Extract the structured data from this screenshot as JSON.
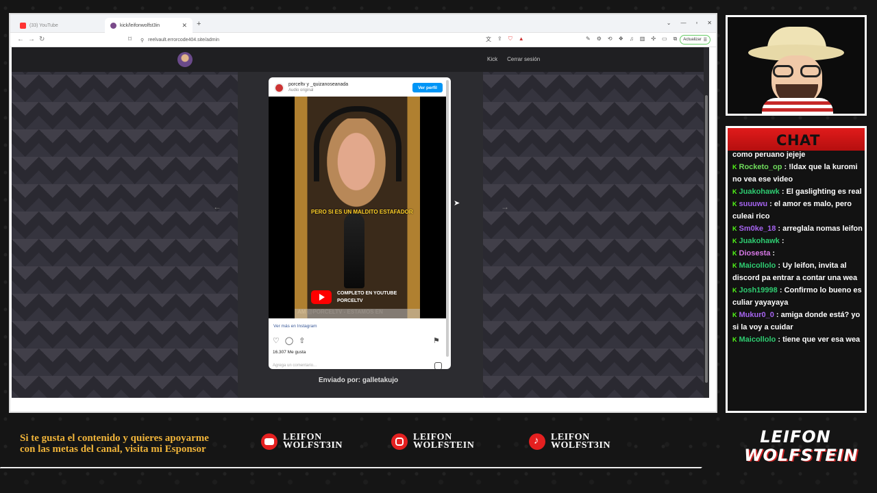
{
  "browser": {
    "tabs": [
      {
        "label": "(33) YouTube"
      },
      {
        "label": "kick/leifonwolfst3in"
      }
    ],
    "new_tab": "+",
    "url": "reelvault.errorcode404.site/admin",
    "update_label": "Actualizar"
  },
  "site": {
    "nav": [
      "Kick",
      "Cerrar sesión"
    ]
  },
  "instagram": {
    "user": "porceltv y _quizanoseanada",
    "sub": "Audio original",
    "profile_button": "Ver perfil",
    "video_caption": "PERO SI ES UN MALDITO ESTAFADOR",
    "promo_line1": "COMPLETO EN YOUTUBE",
    "promo_line2": "PORCELTV",
    "ticker": "AM @PORCELTV - ESTAMOS EN",
    "more_link": "Ver más en Instagram",
    "likes": "16.307 Me gusta",
    "comment_placeholder": "Agrega un comentario..."
  },
  "sent_by": "Enviado por: galletakujo",
  "chat": {
    "title": "CHAT",
    "messages": [
      {
        "user": "",
        "text": "como peruano jejeje",
        "color": "#ffffff"
      },
      {
        "user": "Rocketo_op",
        "text": ": !ldax que la kuromi no vea ese video",
        "color": "#6fdc5c"
      },
      {
        "user": "Juakohawk",
        "text": ": El gaslighting es real",
        "color": "#2ecc71"
      },
      {
        "user": "suuuwu",
        "text": ": el amor es malo, pero culeai rico",
        "color": "#a664f0"
      },
      {
        "user": "Sm0ke_18",
        "text": ": arreglala nomas leifon",
        "color": "#a664f0"
      },
      {
        "user": "Juakohawk",
        "text": ":",
        "color": "#2ecc71"
      },
      {
        "user": "Diosesta",
        "text": ":",
        "color": "#d878e6"
      },
      {
        "user": "Maicollolo",
        "text": ": Uy leifon, invita al discord pa entrar a contar una wea",
        "color": "#2ecc71"
      },
      {
        "user": "Josh19998",
        "text": ": Confirmo lo bueno es culiar yayayaya",
        "color": "#2ecc71"
      },
      {
        "user": "Mukur0_0",
        "text": ": amiga donde está? yo si la voy a cuidar",
        "color": "#a664f0"
      },
      {
        "user": "Maicollolo",
        "text": ": tiene que ver esa wea",
        "color": "#2ecc71"
      }
    ]
  },
  "bottom": {
    "sponsor": "Si te gusta el contenido y quieres apoyarme con las metas del canal, visita mi Esponsor",
    "socials": [
      {
        "line1": "LEIFON",
        "line2": "WOLFST3IN"
      },
      {
        "line1": "LEIFON",
        "line2": "WOLFSTEIN"
      },
      {
        "line1": "LEIFON",
        "line2": "WOLFST3IN"
      }
    ],
    "logo_line1": "LEIFON",
    "logo_line2": "WOLFSTEIN"
  }
}
